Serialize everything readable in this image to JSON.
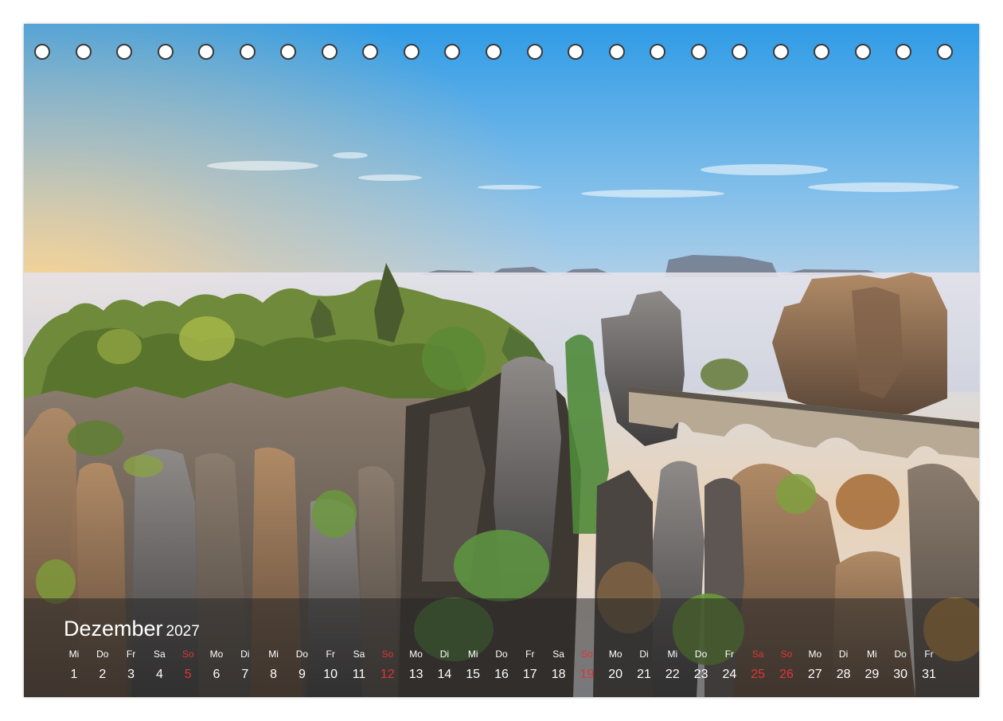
{
  "calendar": {
    "month": "Dezember",
    "year": "2027",
    "weekend_color": "#e03535",
    "days": [
      {
        "name": "Mi",
        "number": "1",
        "weekend": false
      },
      {
        "name": "Do",
        "number": "2",
        "weekend": false
      },
      {
        "name": "Fr",
        "number": "3",
        "weekend": false
      },
      {
        "name": "Sa",
        "number": "4",
        "weekend": false
      },
      {
        "name": "So",
        "number": "5",
        "weekend": true
      },
      {
        "name": "Mo",
        "number": "6",
        "weekend": false
      },
      {
        "name": "Di",
        "number": "7",
        "weekend": false
      },
      {
        "name": "Mi",
        "number": "8",
        "weekend": false
      },
      {
        "name": "Do",
        "number": "9",
        "weekend": false
      },
      {
        "name": "Fr",
        "number": "10",
        "weekend": false
      },
      {
        "name": "Sa",
        "number": "11",
        "weekend": false
      },
      {
        "name": "So",
        "number": "12",
        "weekend": true
      },
      {
        "name": "Mo",
        "number": "13",
        "weekend": false
      },
      {
        "name": "Di",
        "number": "14",
        "weekend": false
      },
      {
        "name": "Mi",
        "number": "15",
        "weekend": false
      },
      {
        "name": "Do",
        "number": "16",
        "weekend": false
      },
      {
        "name": "Fr",
        "number": "17",
        "weekend": false
      },
      {
        "name": "Sa",
        "number": "18",
        "weekend": false
      },
      {
        "name": "So",
        "number": "19",
        "weekend": true
      },
      {
        "name": "Mo",
        "number": "20",
        "weekend": false
      },
      {
        "name": "Di",
        "number": "21",
        "weekend": false
      },
      {
        "name": "Mi",
        "number": "22",
        "weekend": false
      },
      {
        "name": "Do",
        "number": "23",
        "weekend": false
      },
      {
        "name": "Fr",
        "number": "24",
        "weekend": false
      },
      {
        "name": "Sa",
        "number": "25",
        "weekend": true
      },
      {
        "name": "So",
        "number": "26",
        "weekend": true
      },
      {
        "name": "Mo",
        "number": "27",
        "weekend": false
      },
      {
        "name": "Di",
        "number": "28",
        "weekend": false
      },
      {
        "name": "Mi",
        "number": "29",
        "weekend": false
      },
      {
        "name": "Do",
        "number": "30",
        "weekend": false
      },
      {
        "name": "Fr",
        "number": "31",
        "weekend": false
      }
    ]
  },
  "binding": {
    "hole_count": 23
  }
}
